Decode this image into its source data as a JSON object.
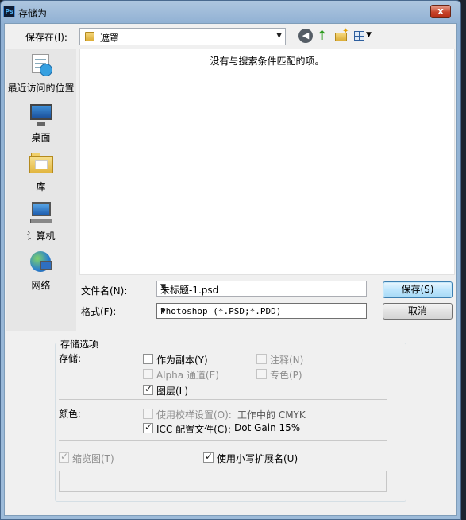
{
  "window": {
    "app_icon_text": "Ps",
    "title": "存储为",
    "close_symbol": "x"
  },
  "toolbar": {
    "save_in_label": "保存在(I):",
    "current_folder": "遮罩",
    "back_icon": "back-arrow-icon",
    "up_icon": "up-folder-icon",
    "new_folder_icon": "new-folder-icon",
    "view_menu_icon": "view-menu-icon"
  },
  "places": [
    {
      "label": "最近访问的位置",
      "icon": "recent-places-icon"
    },
    {
      "label": "桌面",
      "icon": "desktop-icon"
    },
    {
      "label": "库",
      "icon": "library-icon"
    },
    {
      "label": "计算机",
      "icon": "computer-icon"
    },
    {
      "label": "网络",
      "icon": "network-icon"
    }
  ],
  "file_list": {
    "empty_message": "没有与搜索条件匹配的项。"
  },
  "form": {
    "filename_label": "文件名(N):",
    "filename_value": "未标题-1.psd",
    "format_label": "格式(F):",
    "format_value": "Photoshop (*.PSD;*.PDD)",
    "save_button": "保存(S)",
    "cancel_button": "取消"
  },
  "options": {
    "group_title": "存储选项",
    "storage_label": "存储:",
    "as_copy": {
      "label": "作为副本(Y)",
      "checked": false,
      "enabled": true
    },
    "notes": {
      "label": "注释(N)",
      "checked": false,
      "enabled": false
    },
    "alpha_channels": {
      "label": "Alpha 通道(E)",
      "checked": false,
      "enabled": false
    },
    "spot_colors": {
      "label": "专色(P)",
      "checked": false,
      "enabled": false
    },
    "layers": {
      "label": "图层(L)",
      "checked": true,
      "enabled": true
    },
    "color_label": "颜色:",
    "use_proof_setup": {
      "label": "使用校样设置(O):",
      "checked": false,
      "enabled": false
    },
    "proof_setup_value": "工作中的 CMYK",
    "icc_profile": {
      "label": "ICC 配置文件(C):",
      "checked": true,
      "enabled": true
    },
    "icc_profile_value": "Dot Gain 15%",
    "thumbnail": {
      "label": "缩览图(T)",
      "checked": true,
      "enabled": false
    },
    "lowercase_ext": {
      "label": "使用小写扩展名(U)",
      "checked": true,
      "enabled": true
    }
  }
}
